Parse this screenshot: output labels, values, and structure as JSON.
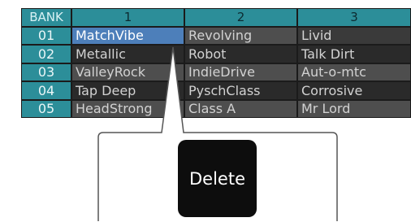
{
  "table": {
    "header": [
      "BANK",
      "1",
      "2",
      "3"
    ],
    "rows": [
      {
        "bank": "01",
        "c1": "MatchVibe",
        "c2": "Revolving",
        "c3": "Livid"
      },
      {
        "bank": "02",
        "c1": "Metallic",
        "c2": "Robot",
        "c3": "Talk Dirt"
      },
      {
        "bank": "03",
        "c1": "ValleyRock",
        "c2": "IndieDrive",
        "c3": "Aut-o-mtc"
      },
      {
        "bank": "04",
        "c1": "Tap Deep",
        "c2": "PyschClass",
        "c3": "Corrosive"
      },
      {
        "bank": "05",
        "c1": "HeadStrong",
        "c2": "Class A",
        "c3": "Mr Lord"
      }
    ],
    "selected": {
      "row": 0,
      "col": 1
    }
  },
  "popup": {
    "delete_label": "Delete"
  },
  "colors": {
    "header": "#2c8e99",
    "selected": "#4d7fba"
  }
}
